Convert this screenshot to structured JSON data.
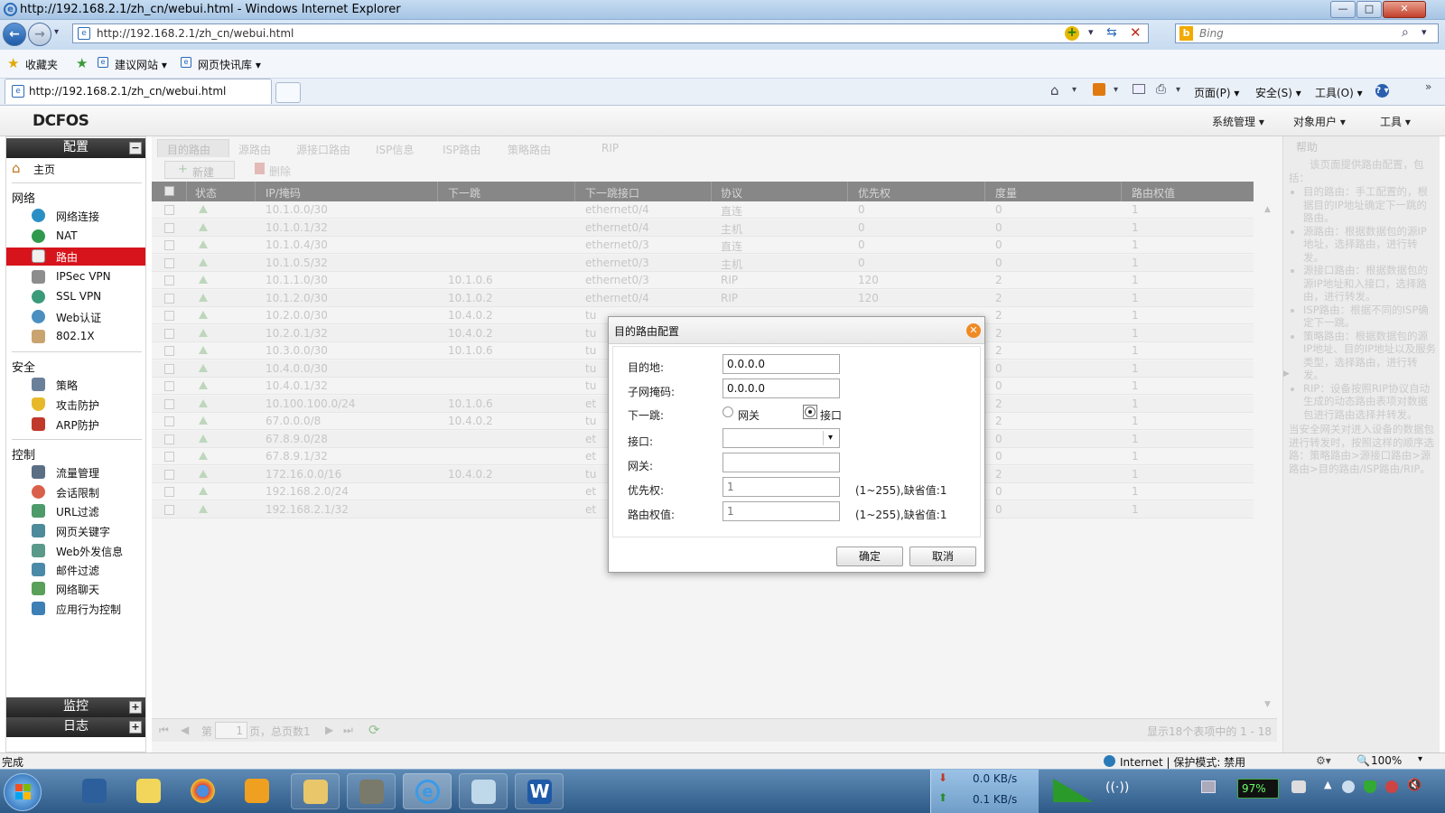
{
  "window": {
    "title": "http://192.168.2.1/zh_cn/webui.html - Windows Internet Explorer",
    "controls": {
      "minimize": "—",
      "maximize": "□",
      "close": "✕"
    }
  },
  "browser": {
    "address": "http://192.168.2.1/zh_cn/webui.html",
    "search_placeholder": "Bing",
    "favorites": {
      "favorites_label": "收藏夹",
      "suggested_sites": "建议网站 ▾",
      "web_slice": "网页快讯库 ▾"
    },
    "tab_title": "http://192.168.2.1/zh_cn/webui.html",
    "commands": {
      "page": "页面(P) ▾",
      "safety": "安全(S) ▾",
      "tools": "工具(O) ▾",
      "help": "? ▾"
    }
  },
  "app": {
    "brand": "DCFOS",
    "menus": [
      "系统管理 ▾",
      "对象用户 ▾",
      "工具 ▾"
    ]
  },
  "sidebar": {
    "config_header": "配置",
    "home": "主页",
    "sections": {
      "network": {
        "title": "网络",
        "items": [
          "网络连接",
          "NAT",
          "路由",
          "IPSec VPN",
          "SSL VPN",
          "Web认证",
          "802.1X"
        ]
      },
      "security": {
        "title": "安全",
        "items": [
          "策略",
          "攻击防护",
          "ARP防护"
        ]
      },
      "control": {
        "title": "控制",
        "items": [
          "流量管理",
          "会话限制",
          "URL过滤",
          "网页关键字",
          "Web外发信息",
          "邮件过滤",
          "网络聊天",
          "应用行为控制"
        ]
      }
    },
    "monitor_header": "监控",
    "log_header": "日志"
  },
  "tabs": [
    "目的路由",
    "源路由",
    "源接口路由",
    "ISP信息",
    "ISP路由",
    "策略路由",
    "RIP"
  ],
  "toolbar": {
    "new": "新建",
    "delete": "删除"
  },
  "grid": {
    "columns": [
      "状态",
      "IP/掩码",
      "下一跳",
      "下一跳接口",
      "协议",
      "优先权",
      "度量",
      "路由权值"
    ],
    "rows": [
      [
        "10.1.0.0/30",
        "",
        "ethernet0/4",
        "直连",
        "0",
        "0",
        "1"
      ],
      [
        "10.1.0.1/32",
        "",
        "ethernet0/4",
        "主机",
        "0",
        "0",
        "1"
      ],
      [
        "10.1.0.4/30",
        "",
        "ethernet0/3",
        "直连",
        "0",
        "0",
        "1"
      ],
      [
        "10.1.0.5/32",
        "",
        "ethernet0/3",
        "主机",
        "0",
        "0",
        "1"
      ],
      [
        "10.1.1.0/30",
        "10.1.0.6",
        "ethernet0/3",
        "RIP",
        "120",
        "2",
        "1"
      ],
      [
        "10.1.2.0/30",
        "10.1.0.2",
        "ethernet0/4",
        "RIP",
        "120",
        "2",
        "1"
      ],
      [
        "10.2.0.0/30",
        "10.4.0.2",
        "tu",
        "",
        "",
        "2",
        "1"
      ],
      [
        "10.2.0.1/32",
        "10.4.0.2",
        "tu",
        "",
        "",
        "2",
        "1"
      ],
      [
        "10.3.0.0/30",
        "10.1.0.6",
        "tu",
        "",
        "",
        "2",
        "1"
      ],
      [
        "10.4.0.0/30",
        "",
        "tu",
        "",
        "",
        "0",
        "1"
      ],
      [
        "10.4.0.1/32",
        "",
        "tu",
        "",
        "",
        "0",
        "1"
      ],
      [
        "10.100.100.0/24",
        "10.1.0.6",
        "et",
        "",
        "",
        "2",
        "1"
      ],
      [
        "67.0.0.0/8",
        "10.4.0.2",
        "tu",
        "",
        "",
        "2",
        "1"
      ],
      [
        "67.8.9.0/28",
        "",
        "et",
        "",
        "",
        "0",
        "1"
      ],
      [
        "67.8.9.1/32",
        "",
        "et",
        "",
        "",
        "0",
        "1"
      ],
      [
        "172.16.0.0/16",
        "10.4.0.2",
        "tu",
        "",
        "",
        "2",
        "1"
      ],
      [
        "192.168.2.0/24",
        "",
        "et",
        "",
        "",
        "0",
        "1"
      ],
      [
        "192.168.2.1/32",
        "",
        "et",
        "",
        "",
        "0",
        "1"
      ]
    ]
  },
  "pager": {
    "page_prefix": "第",
    "page_value": "1",
    "page_suffix": "页，总页数1",
    "summary": "显示18个表项中的 1 - 18"
  },
  "help": {
    "title": "帮助",
    "intro": "该页面提供路由配置，包括：",
    "bullets": [
      "目的路由：手工配置的，根据目的IP地址确定下一跳的路由。",
      "源路由：根据数据包的源IP地址，选择路由，进行转发。",
      "源接口路由：根据数据包的源IP地址和入接口，选择路由，进行转发。",
      "ISP路由：根据不同的ISP确定下一跳。",
      "策略路由：根据数据包的源IP地址、目的IP地址以及服务类型，选择路由，进行转发。",
      "RIP：设备按照RIP协议自动生成的动态路由表项对数据包进行路由选择并转发。"
    ],
    "footer": "当安全网关对进入设备的数据包进行转发时，按照这样的顺序选路：策略路由>源接口路由>源路由>目的路由/ISP路由/RIP。"
  },
  "dialog": {
    "title": "目的路由配置",
    "destination_label": "目的地:",
    "destination_value": "0.0.0.0",
    "mask_label": "子网掩码:",
    "mask_value": "0.0.0.0",
    "nexthop_label": "下一跳:",
    "radio_gateway": "网关",
    "radio_interface": "接口",
    "interface_label": "接口:",
    "gateway_label": "网关:",
    "priority_label": "优先权:",
    "priority_placeholder": "1",
    "priority_hint": "(1~255),缺省值:1",
    "weight_label": "路由权值:",
    "weight_placeholder": "1",
    "weight_hint": "(1~255),缺省值:1",
    "ok": "确定",
    "cancel": "取消"
  },
  "statusbar": {
    "left": "完成",
    "zone": "Internet | 保护模式: 禁用",
    "zoom": "100%"
  },
  "taskbar": {
    "download": "0.0 KB/s",
    "upload": "0.1 KB/s",
    "battery": "97%"
  },
  "colors": {
    "active_menu": "#d7141c",
    "dark_header": "#232323",
    "overlay": "rgba(0,0,0,0.35)"
  }
}
